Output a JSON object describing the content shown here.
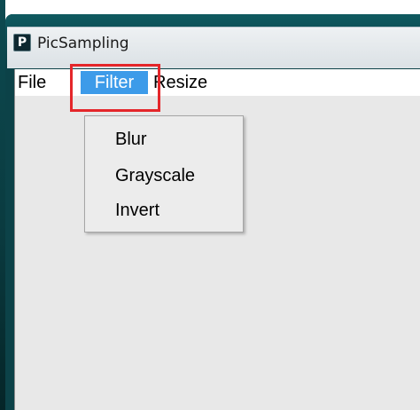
{
  "window": {
    "title": "PicSampling",
    "icon_glyph": "P"
  },
  "menubar": {
    "items": [
      {
        "label": "File"
      },
      {
        "label": "Filter",
        "state": "open"
      },
      {
        "label": "Resize"
      }
    ]
  },
  "dropdown": {
    "parent": "Filter",
    "items": [
      {
        "label": "Blur"
      },
      {
        "label": "Grayscale"
      },
      {
        "label": "Invert"
      }
    ]
  },
  "colors": {
    "menu_selected_bg": "#3d9be9",
    "highlight_box": "#e4262a",
    "title_bar": "#0c4248"
  }
}
